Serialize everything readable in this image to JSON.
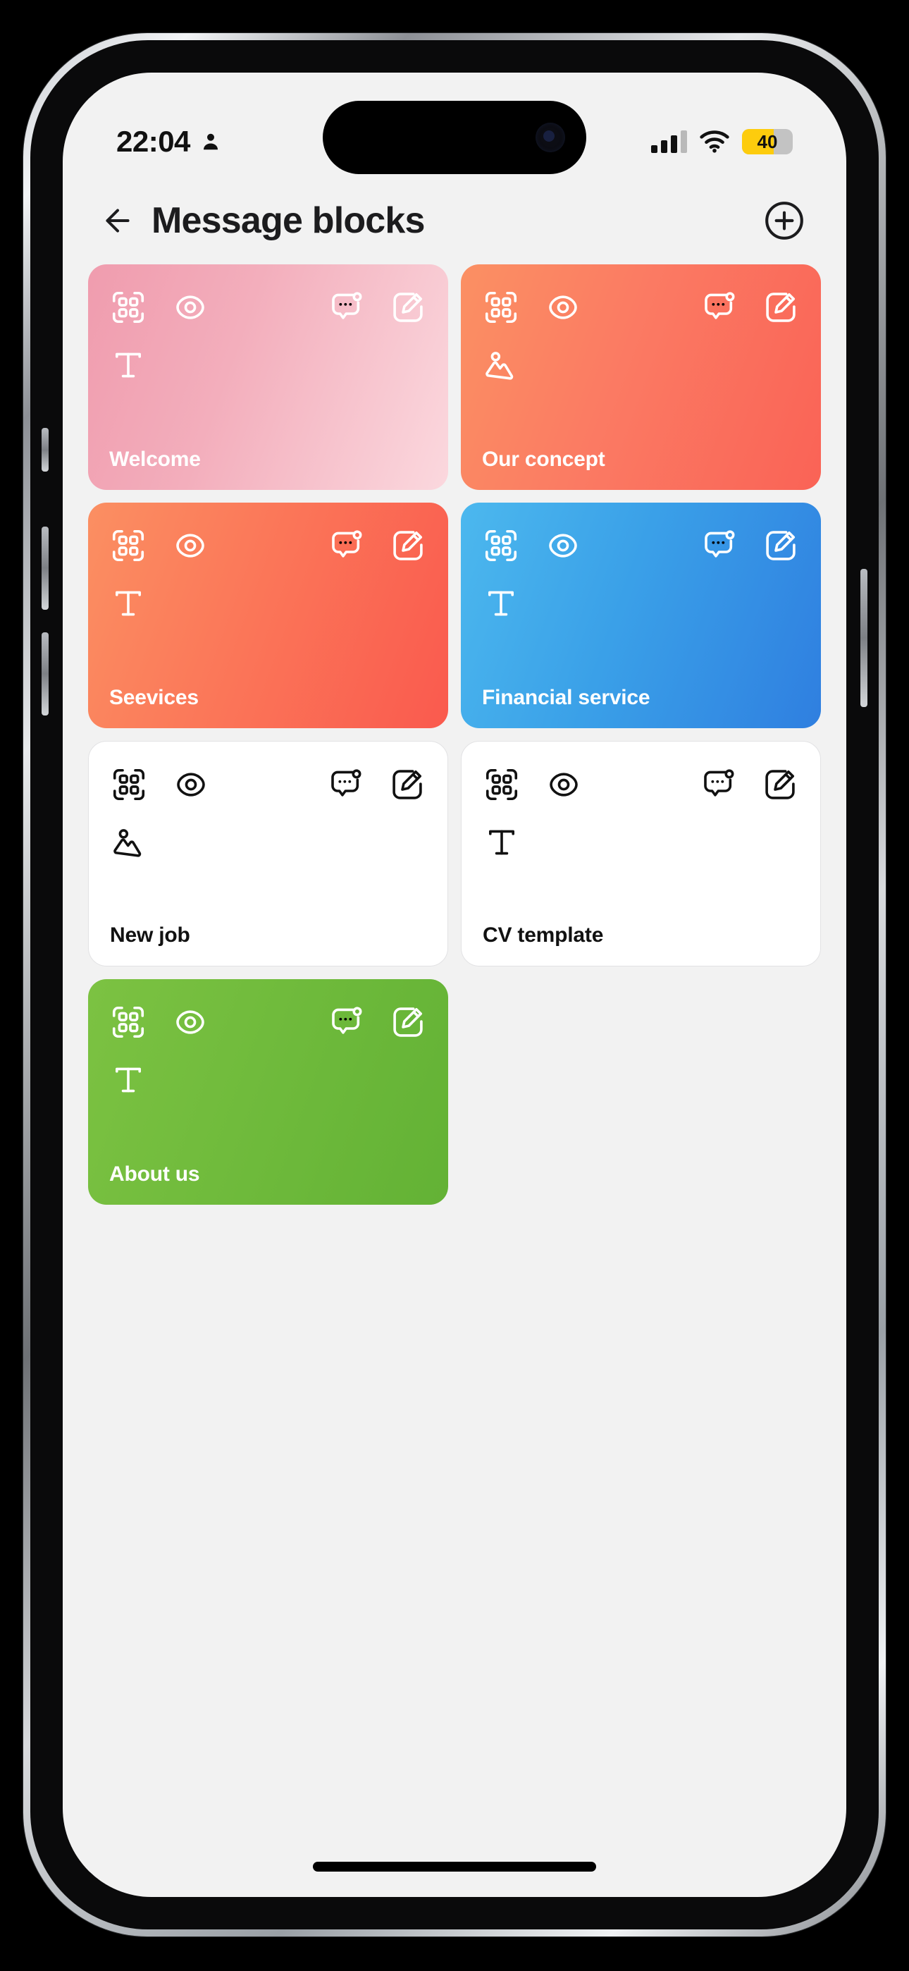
{
  "status_bar": {
    "time": "22:04",
    "person_icon": "person-icon",
    "signal_icon": "cellular-signal-icon",
    "signal_bars_filled": 3,
    "signal_bars_total": 4,
    "wifi_icon": "wifi-icon",
    "battery_percent": "40",
    "battery_icon": "battery-low-power-icon",
    "battery_color": "#fdcc0d"
  },
  "header": {
    "back_icon": "arrow-left-icon",
    "title": "Message blocks",
    "add_icon": "plus-circle-icon"
  },
  "card_icons": {
    "qr": "qr-scan-icon",
    "eye": "eye-icon",
    "chat": "chat-bubble-dots-icon",
    "edit": "edit-pencil-icon",
    "text": "text-type-icon",
    "image": "image-photo-icon"
  },
  "blocks": [
    {
      "label": "Welcome",
      "theme": "pink",
      "content_type": "text",
      "text_color": "#ffffff",
      "accent": "#f2a7b6"
    },
    {
      "label": "Our concept",
      "theme": "coral",
      "content_type": "image",
      "text_color": "#ffffff",
      "accent": "#fb7a63"
    },
    {
      "label": "Seevices",
      "theme": "red",
      "content_type": "text",
      "text_color": "#ffffff",
      "accent": "#fa6353"
    },
    {
      "label": "Financial service",
      "theme": "blue",
      "content_type": "text",
      "text_color": "#ffffff",
      "accent": "#3a9ce7"
    },
    {
      "label": "New job",
      "theme": "white",
      "content_type": "image",
      "text_color": "#111111",
      "accent": "#ffffff"
    },
    {
      "label": "CV template",
      "theme": "white",
      "content_type": "text",
      "text_color": "#111111",
      "accent": "#ffffff"
    },
    {
      "label": "About us",
      "theme": "green",
      "content_type": "text",
      "text_color": "#ffffff",
      "accent": "#70bb3c"
    }
  ],
  "home_indicator": "home-indicator"
}
